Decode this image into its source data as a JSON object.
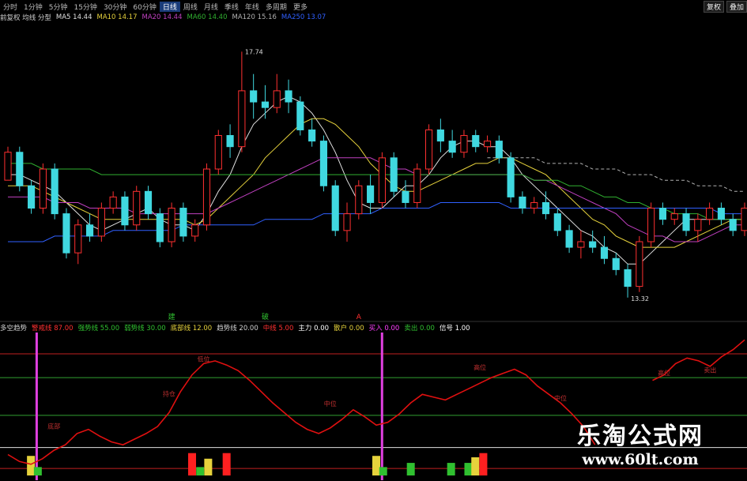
{
  "toolbar": {
    "periods": [
      "分时",
      "1分钟",
      "5分钟",
      "15分钟",
      "30分钟",
      "60分钟",
      "日线",
      "周线",
      "月线",
      "季线",
      "年线",
      "多周期",
      "更多"
    ],
    "active_index": 6,
    "right_buttons": [
      "复权",
      "叠加"
    ]
  },
  "legend_main": [
    {
      "text": "前复权 均线 分型",
      "color": "#d0d0d0"
    },
    {
      "text": "MA5  14.44",
      "color": "#e0e0e0"
    },
    {
      "text": "MA10  14.17",
      "color": "#e6d23c"
    },
    {
      "text": "MA20  14.44",
      "color": "#c040c0"
    },
    {
      "text": "MA60  14.40",
      "color": "#30b030"
    },
    {
      "text": "MA120  15.16",
      "color": "#b0b0b0"
    },
    {
      "text": "MA250  13.07",
      "color": "#3060ff"
    }
  ],
  "legend_ind": [
    {
      "text": "多空趋势",
      "color": "#d0d0d0"
    },
    {
      "text": "警戒线  87.00",
      "color": "#ff3030"
    },
    {
      "text": "强势线  55.00",
      "color": "#30c030"
    },
    {
      "text": "弱势线  30.00",
      "color": "#30c030"
    },
    {
      "text": "底部线  12.00",
      "color": "#e6d23c"
    },
    {
      "text": "趋势线  20.00",
      "color": "#d0d0d0"
    },
    {
      "text": "中线  5.00",
      "color": "#ff3030"
    },
    {
      "text": "主力  0.00",
      "color": "#fff"
    },
    {
      "text": "散户  0.00",
      "color": "#e6d23c"
    },
    {
      "text": "买入  0.00",
      "color": "#ff40ff"
    },
    {
      "text": "卖出  0.00",
      "color": "#30c030"
    },
    {
      "text": "信号  1.00",
      "color": "#fff"
    }
  ],
  "watermark": {
    "title": "乐淘公式网",
    "url": "www.60lt.com"
  },
  "chart_data": [
    {
      "type": "candlestick",
      "annotations": {
        "high_label": "17.74",
        "low_label": "13.32"
      },
      "markers": [
        {
          "text": "建",
          "color": "#30c030",
          "index": 14
        },
        {
          "text": "破",
          "color": "#30c030",
          "index": 22
        },
        {
          "text": "A",
          "color": "#ff3030",
          "index": 30
        }
      ],
      "ylim": [
        13.0,
        18.2
      ],
      "up_color": "#ff3030",
      "down_color": "#40d8e0",
      "candles": [
        [
          15.4,
          15.9,
          15.5,
          16.0
        ],
        [
          15.9,
          15.3,
          15.2,
          16.0
        ],
        [
          15.3,
          14.9,
          14.8,
          15.4
        ],
        [
          14.9,
          15.6,
          14.8,
          15.7
        ],
        [
          15.6,
          14.8,
          14.7,
          15.7
        ],
        [
          14.8,
          14.1,
          14.0,
          14.9
        ],
        [
          14.1,
          14.6,
          13.9,
          14.7
        ],
        [
          14.6,
          14.4,
          14.3,
          14.8
        ],
        [
          14.4,
          14.9,
          14.3,
          15.0
        ],
        [
          14.9,
          15.1,
          14.8,
          15.2
        ],
        [
          15.1,
          14.6,
          14.5,
          15.2
        ],
        [
          14.6,
          15.2,
          14.5,
          15.3
        ],
        [
          15.2,
          14.8,
          14.7,
          15.3
        ],
        [
          14.8,
          14.3,
          14.2,
          14.9
        ],
        [
          14.3,
          14.9,
          14.2,
          15.0
        ],
        [
          14.9,
          14.4,
          14.3,
          15.0
        ],
        [
          14.4,
          14.6,
          14.3,
          14.7
        ],
        [
          14.6,
          15.6,
          14.5,
          15.7
        ],
        [
          15.6,
          16.2,
          15.5,
          16.3
        ],
        [
          16.2,
          16.0,
          15.8,
          16.4
        ],
        [
          16.0,
          17.0,
          15.9,
          17.7
        ],
        [
          17.0,
          16.8,
          16.5,
          17.3
        ],
        [
          16.8,
          16.7,
          16.5,
          17.1
        ],
        [
          16.7,
          17.0,
          16.6,
          17.3
        ],
        [
          17.0,
          16.8,
          16.6,
          17.2
        ],
        [
          16.8,
          16.3,
          16.2,
          16.9
        ],
        [
          16.3,
          16.1,
          16.0,
          16.5
        ],
        [
          16.1,
          15.3,
          15.2,
          16.2
        ],
        [
          15.3,
          14.5,
          14.4,
          15.4
        ],
        [
          14.5,
          14.8,
          14.3,
          15.0
        ],
        [
          14.8,
          15.3,
          14.7,
          15.4
        ],
        [
          15.3,
          15.0,
          14.8,
          15.5
        ],
        [
          15.0,
          15.8,
          14.9,
          15.9
        ],
        [
          15.8,
          15.2,
          15.1,
          15.9
        ],
        [
          15.2,
          15.0,
          14.9,
          15.4
        ],
        [
          15.0,
          15.6,
          14.9,
          15.7
        ],
        [
          15.6,
          16.3,
          15.5,
          16.4
        ],
        [
          16.3,
          16.1,
          15.9,
          16.5
        ],
        [
          16.1,
          15.9,
          15.8,
          16.3
        ],
        [
          15.9,
          16.2,
          15.8,
          16.3
        ],
        [
          16.2,
          16.0,
          15.9,
          16.3
        ],
        [
          16.0,
          16.1,
          15.9,
          16.2
        ],
        [
          16.1,
          15.8,
          15.7,
          16.2
        ],
        [
          15.8,
          15.1,
          15.0,
          15.9
        ],
        [
          15.1,
          14.9,
          14.8,
          15.2
        ],
        [
          14.9,
          15.0,
          14.8,
          15.1
        ],
        [
          15.0,
          14.8,
          14.7,
          15.2
        ],
        [
          14.8,
          14.5,
          14.4,
          14.9
        ],
        [
          14.5,
          14.2,
          14.1,
          14.6
        ],
        [
          14.2,
          14.3,
          14.0,
          14.5
        ],
        [
          14.3,
          14.2,
          14.1,
          14.5
        ],
        [
          14.2,
          14.0,
          13.9,
          14.4
        ],
        [
          14.0,
          13.8,
          13.7,
          14.1
        ],
        [
          13.8,
          13.5,
          13.3,
          13.9
        ],
        [
          13.5,
          14.3,
          13.4,
          14.4
        ],
        [
          14.3,
          14.9,
          14.2,
          15.0
        ],
        [
          14.9,
          14.7,
          14.6,
          15.0
        ],
        [
          14.7,
          14.8,
          14.6,
          14.9
        ],
        [
          14.8,
          14.5,
          14.4,
          14.9
        ],
        [
          14.5,
          14.7,
          14.3,
          14.8
        ],
        [
          14.7,
          14.9,
          14.6,
          15.0
        ],
        [
          14.9,
          14.7,
          14.6,
          15.0
        ],
        [
          14.7,
          14.5,
          14.4,
          14.8
        ],
        [
          14.5,
          14.9,
          14.4,
          15.0
        ]
      ],
      "ma": [
        {
          "name": "MA5",
          "color": "#e0e0e0",
          "values": [
            15.5,
            15.5,
            15.4,
            15.3,
            15.2,
            15.0,
            14.8,
            14.6,
            14.5,
            14.6,
            14.7,
            14.8,
            14.9,
            14.7,
            14.6,
            14.6,
            14.5,
            14.8,
            15.2,
            15.5,
            16.0,
            16.4,
            16.6,
            16.8,
            16.9,
            16.8,
            16.6,
            16.3,
            15.9,
            15.4,
            15.0,
            14.9,
            14.9,
            15.1,
            15.3,
            15.3,
            15.5,
            15.8,
            16.0,
            16.1,
            16.1,
            16.0,
            16.0,
            15.8,
            15.5,
            15.3,
            15.1,
            14.9,
            14.7,
            14.5,
            14.4,
            14.2,
            14.1,
            13.9,
            13.9,
            14.1,
            14.3,
            14.5,
            14.7,
            14.7,
            14.7,
            14.7,
            14.7,
            14.7
          ]
        },
        {
          "name": "MA10",
          "color": "#e6d23c",
          "values": [
            15.3,
            15.3,
            15.3,
            15.2,
            15.1,
            15.0,
            14.9,
            14.8,
            14.7,
            14.7,
            14.7,
            14.7,
            14.7,
            14.7,
            14.7,
            14.7,
            14.6,
            14.7,
            14.9,
            15.1,
            15.3,
            15.5,
            15.8,
            16.0,
            16.2,
            16.4,
            16.5,
            16.5,
            16.4,
            16.2,
            16.0,
            15.7,
            15.5,
            15.3,
            15.2,
            15.2,
            15.3,
            15.4,
            15.5,
            15.6,
            15.7,
            15.7,
            15.8,
            15.8,
            15.7,
            15.6,
            15.5,
            15.3,
            15.1,
            14.9,
            14.7,
            14.6,
            14.4,
            14.3,
            14.2,
            14.2,
            14.2,
            14.2,
            14.3,
            14.4,
            14.5,
            14.6,
            14.7,
            14.7
          ]
        },
        {
          "name": "MA20",
          "color": "#c040c0",
          "values": [
            15.1,
            15.1,
            15.1,
            15.1,
            15.0,
            15.0,
            15.0,
            14.9,
            14.9,
            14.9,
            14.9,
            14.8,
            14.8,
            14.8,
            14.8,
            14.8,
            14.8,
            14.8,
            14.9,
            15.0,
            15.1,
            15.2,
            15.3,
            15.4,
            15.5,
            15.6,
            15.7,
            15.8,
            15.8,
            15.8,
            15.8,
            15.8,
            15.7,
            15.6,
            15.6,
            15.5,
            15.5,
            15.5,
            15.5,
            15.5,
            15.5,
            15.5,
            15.5,
            15.5,
            15.5,
            15.4,
            15.4,
            15.3,
            15.2,
            15.1,
            15.0,
            14.9,
            14.8,
            14.6,
            14.5,
            14.4,
            14.4,
            14.3,
            14.3,
            14.3,
            14.4,
            14.5,
            14.6,
            14.6
          ]
        },
        {
          "name": "MA60",
          "color": "#30b030",
          "values": [
            15.7,
            15.7,
            15.7,
            15.6,
            15.6,
            15.6,
            15.6,
            15.6,
            15.5,
            15.5,
            15.5,
            15.5,
            15.5,
            15.5,
            15.5,
            15.5,
            15.5,
            15.5,
            15.5,
            15.5,
            15.5,
            15.5,
            15.5,
            15.5,
            15.5,
            15.5,
            15.5,
            15.5,
            15.5,
            15.5,
            15.5,
            15.5,
            15.5,
            15.5,
            15.5,
            15.5,
            15.5,
            15.5,
            15.5,
            15.5,
            15.5,
            15.5,
            15.5,
            15.5,
            15.5,
            15.4,
            15.4,
            15.4,
            15.3,
            15.3,
            15.2,
            15.1,
            15.1,
            15.0,
            15.0,
            14.9,
            14.9,
            14.8,
            14.8,
            14.8,
            14.7,
            14.7,
            14.7,
            14.7
          ]
        },
        {
          "name": "MA120",
          "color": "#b0b0b0",
          "values": [
            null,
            null,
            null,
            null,
            null,
            null,
            null,
            null,
            null,
            null,
            null,
            null,
            null,
            null,
            null,
            null,
            null,
            null,
            null,
            null,
            null,
            null,
            null,
            null,
            null,
            null,
            null,
            null,
            null,
            null,
            null,
            null,
            null,
            null,
            null,
            null,
            null,
            null,
            null,
            null,
            null,
            15.8,
            15.8,
            15.8,
            15.8,
            15.8,
            15.7,
            15.7,
            15.7,
            15.7,
            15.6,
            15.6,
            15.6,
            15.5,
            15.5,
            15.5,
            15.4,
            15.4,
            15.4,
            15.3,
            15.3,
            15.3,
            15.2,
            15.2
          ]
        },
        {
          "name": "MA250",
          "color": "#3060ff",
          "values": [
            14.3,
            14.3,
            14.3,
            14.3,
            14.4,
            14.4,
            14.4,
            14.4,
            14.4,
            14.5,
            14.5,
            14.5,
            14.5,
            14.5,
            14.5,
            14.6,
            14.6,
            14.6,
            14.6,
            14.6,
            14.6,
            14.6,
            14.7,
            14.7,
            14.7,
            14.7,
            14.7,
            14.8,
            14.8,
            14.8,
            14.8,
            14.8,
            14.9,
            14.9,
            14.9,
            14.9,
            14.9,
            15.0,
            15.0,
            15.0,
            15.0,
            15.0,
            15.0,
            14.9,
            14.9,
            14.9,
            14.9,
            14.9,
            14.9,
            14.9,
            14.9,
            14.9,
            14.9,
            14.9,
            14.9,
            14.9,
            14.9,
            14.9,
            14.9,
            14.9,
            14.9,
            14.8,
            14.8,
            14.8
          ]
        }
      ]
    },
    {
      "type": "line",
      "ylim": [
        0,
        100
      ],
      "hlines": [
        {
          "value": 87,
          "color": "#c02020"
        },
        {
          "value": 70,
          "color": "#30a030"
        },
        {
          "value": 43,
          "color": "#30a030"
        },
        {
          "value": 20,
          "color": "#e0e0e0"
        },
        {
          "value": 5,
          "color": "#c02020"
        }
      ],
      "vlines": [
        2.5,
        32.5
      ],
      "series": [
        {
          "color": "#e01010",
          "values": [
            15,
            10,
            8,
            12,
            18,
            22,
            30,
            33,
            28,
            24,
            22,
            26,
            30,
            35,
            45,
            60,
            72,
            80,
            82,
            79,
            75,
            68,
            60,
            52,
            45,
            38,
            33,
            30,
            34,
            40,
            47,
            42,
            36,
            38,
            44,
            52,
            58,
            56,
            54,
            58,
            62,
            66,
            70,
            73,
            76,
            72,
            64,
            58,
            52,
            44,
            35,
            22,
            null,
            null,
            null,
            null,
            68,
            72,
            80,
            84,
            82,
            78,
            85,
            90,
            97
          ]
        }
      ],
      "labels": [
        {
          "index": 4,
          "value": 32,
          "text": "底部"
        },
        {
          "index": 17,
          "value": 80,
          "text": "低位"
        },
        {
          "index": 14,
          "value": 55,
          "text": "持仓"
        },
        {
          "index": 28,
          "value": 48,
          "text": "中位"
        },
        {
          "index": 41,
          "value": 74,
          "text": "高位"
        },
        {
          "index": 48,
          "value": 52,
          "text": "中位"
        },
        {
          "index": 57,
          "value": 70,
          "text": "高位"
        },
        {
          "index": 61,
          "value": 72,
          "text": "卖出"
        }
      ],
      "bars": [
        {
          "index": 2,
          "value": 14,
          "color": "#e6d23c"
        },
        {
          "index": 2.6,
          "value": 6,
          "color": "#30c030"
        },
        {
          "index": 16,
          "value": 16,
          "color": "#ff2020"
        },
        {
          "index": 16.7,
          "value": 6,
          "color": "#30c030"
        },
        {
          "index": 17.4,
          "value": 12,
          "color": "#e6d23c"
        },
        {
          "index": 19,
          "value": 16,
          "color": "#ff2020"
        },
        {
          "index": 32,
          "value": 14,
          "color": "#e6d23c"
        },
        {
          "index": 32.6,
          "value": 6,
          "color": "#30c030"
        },
        {
          "index": 35,
          "value": 9,
          "color": "#30c030"
        },
        {
          "index": 38.5,
          "value": 9,
          "color": "#30c030"
        },
        {
          "index": 40,
          "value": 9,
          "color": "#30c030"
        },
        {
          "index": 40.6,
          "value": 13,
          "color": "#e6d23c"
        },
        {
          "index": 41.3,
          "value": 16,
          "color": "#ff2020"
        }
      ]
    }
  ]
}
